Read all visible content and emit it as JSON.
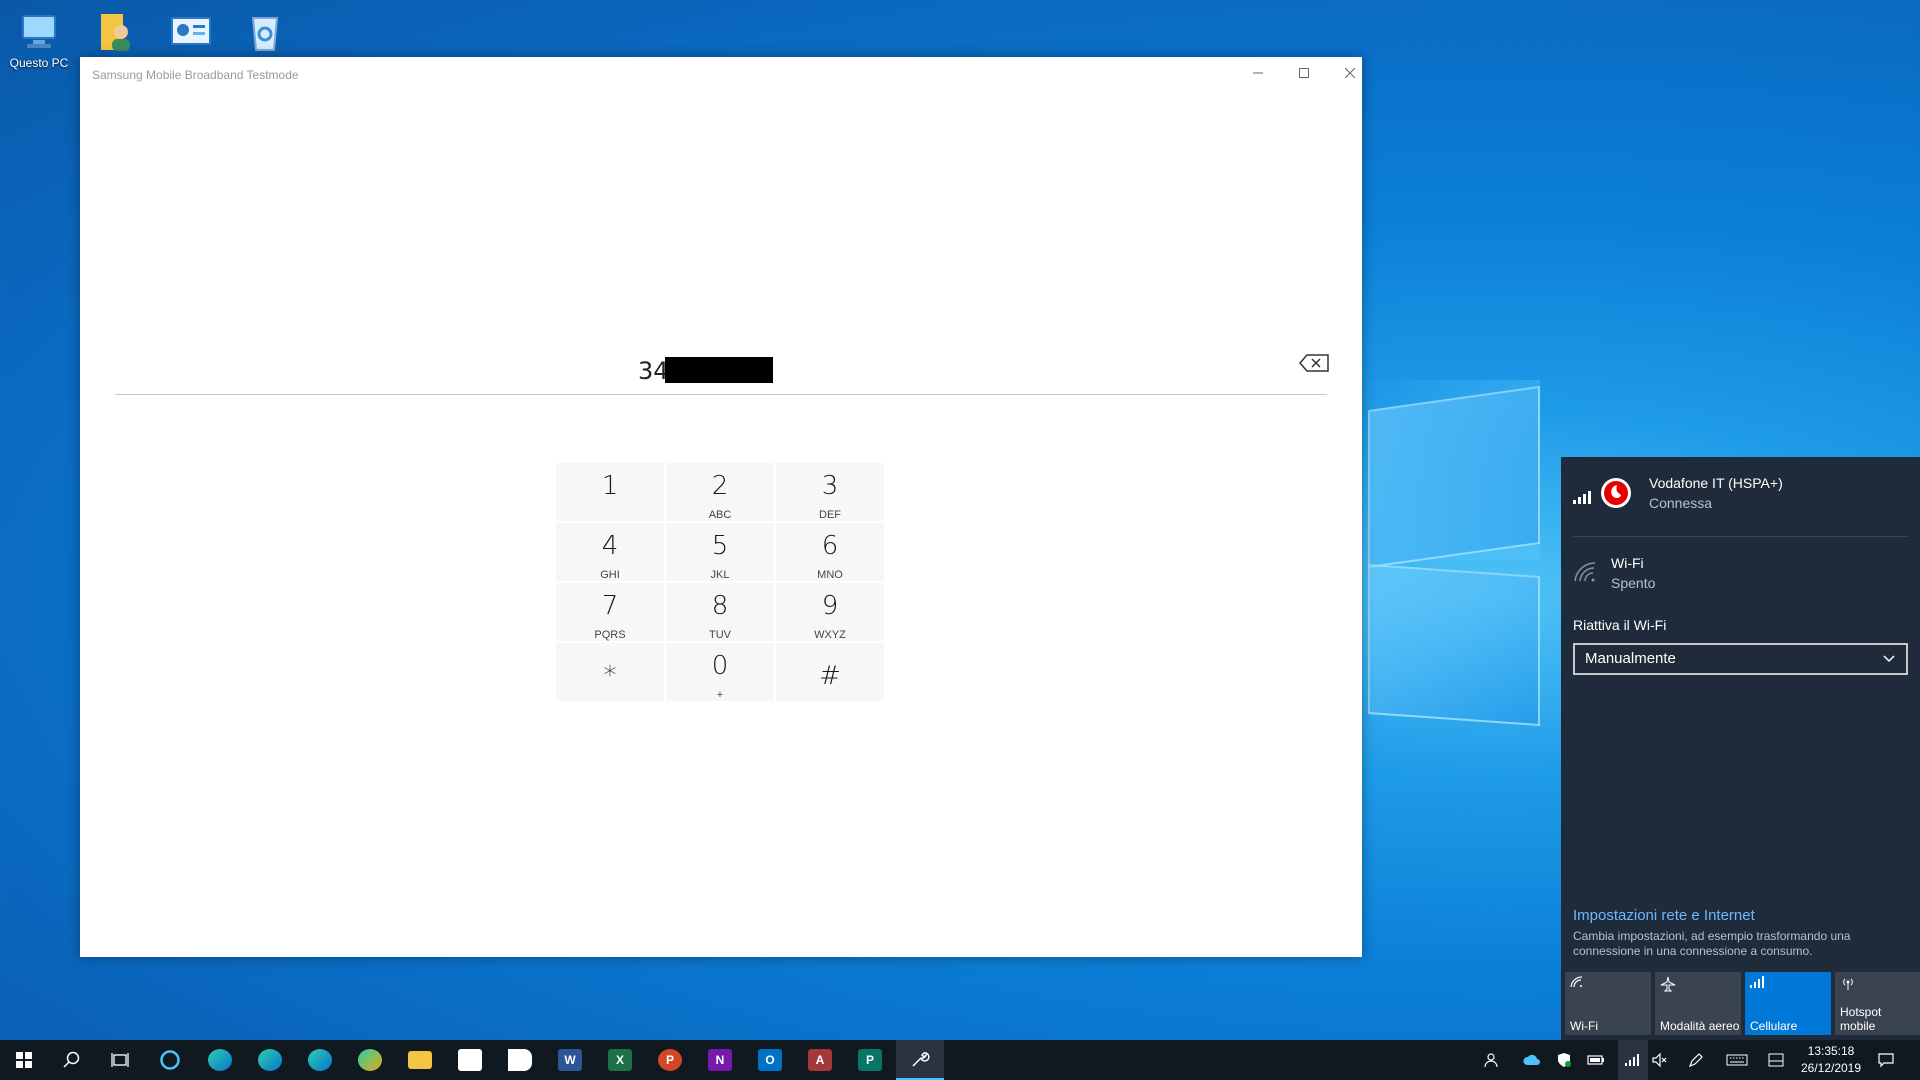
{
  "desktop": {
    "icons": [
      {
        "label": "Questo PC",
        "icon": "computer-icon"
      },
      {
        "label": "",
        "icon": "user-folder-icon"
      },
      {
        "label": "",
        "icon": "control-panel-icon"
      },
      {
        "label": "",
        "icon": "recycle-bin-icon"
      }
    ]
  },
  "window": {
    "title": "Samsung Mobile Broadband Testmode",
    "number": "34"
  },
  "keypad": [
    {
      "digit": "1",
      "letters": ""
    },
    {
      "digit": "2",
      "letters": "ABC"
    },
    {
      "digit": "3",
      "letters": "DEF"
    },
    {
      "digit": "4",
      "letters": "GHI"
    },
    {
      "digit": "5",
      "letters": "JKL"
    },
    {
      "digit": "6",
      "letters": "MNO"
    },
    {
      "digit": "7",
      "letters": "PQRS"
    },
    {
      "digit": "8",
      "letters": "TUV"
    },
    {
      "digit": "9",
      "letters": "WXYZ"
    },
    {
      "digit": "*",
      "letters": ""
    },
    {
      "digit": "0",
      "letters": "+"
    },
    {
      "digit": "#",
      "letters": ""
    }
  ],
  "network": {
    "cellular_name": "Vodafone IT (HSPA+)",
    "cellular_status": "Connessa",
    "wifi_name": "Wi-Fi",
    "wifi_status": "Spento",
    "reenable_label": "Riattiva il Wi-Fi",
    "reenable_value": "Manualmente",
    "settings_link": "Impostazioni rete e Internet",
    "settings_desc": "Cambia impostazioni, ad esempio trasformando una connessione in una connessione a consumo.",
    "tiles": [
      {
        "label": "Wi-Fi",
        "active": false
      },
      {
        "label": "Modalità aereo",
        "active": false
      },
      {
        "label": "Cellulare",
        "active": true
      },
      {
        "label": "Hotspot mobile",
        "active": false
      }
    ]
  },
  "taskbar": {
    "apps": [
      "start",
      "search",
      "task-view",
      "cortana",
      "edge",
      "edge-beta",
      "edge-dev",
      "edge-canary",
      "file-explorer",
      "store",
      "vpn-app",
      "word",
      "excel",
      "powerpoint",
      "onenote",
      "outlook",
      "access",
      "publisher",
      "tools"
    ],
    "time": "13:35:18",
    "date": "26/12/2019"
  },
  "colors": {
    "accent": "#0078d7",
    "flyout_bg": "#1f2b3a",
    "taskbar_bg": "#101820",
    "link": "#6bb8ff"
  }
}
